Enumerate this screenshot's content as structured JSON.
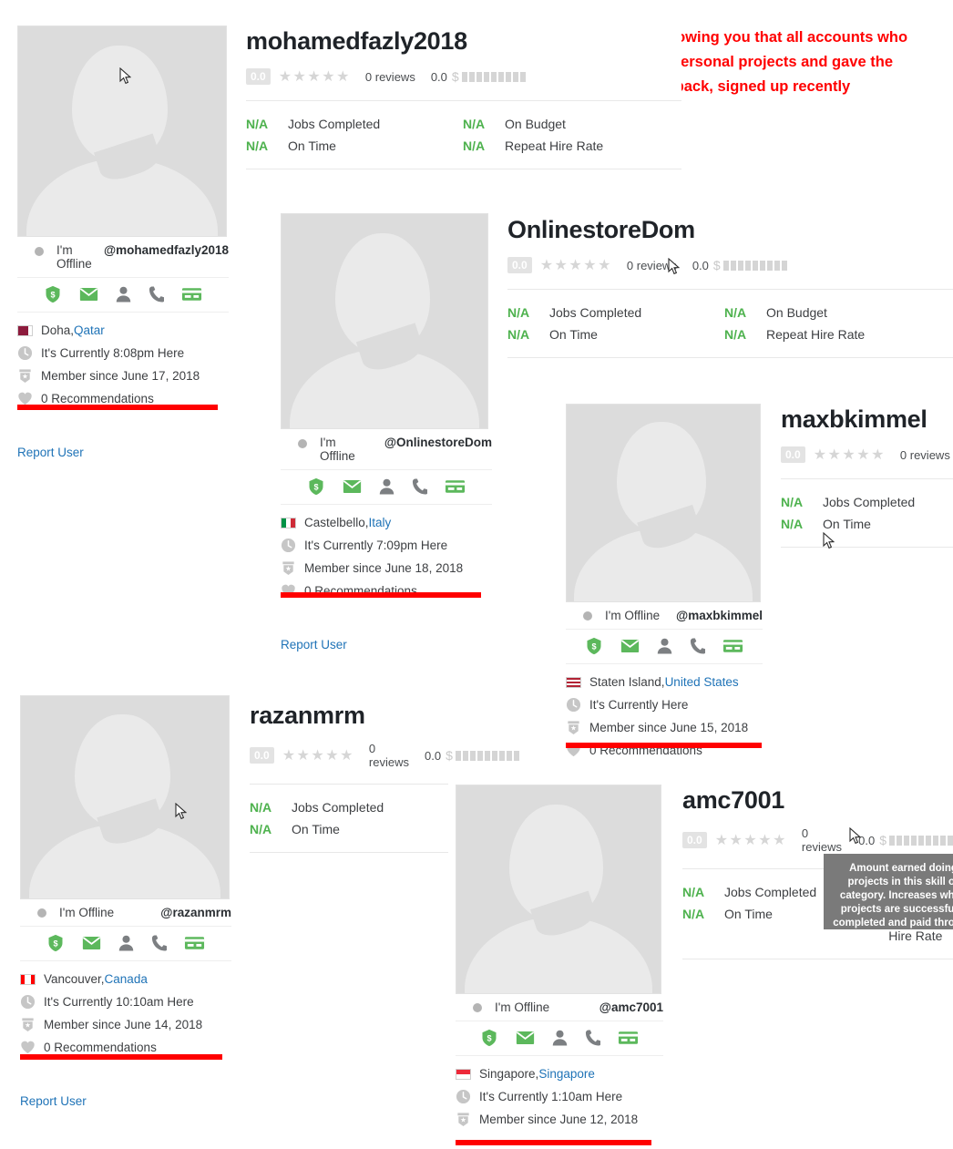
{
  "annotation": {
    "line1": "Here i am showing you that all accounts who",
    "line2": "made the personal projects and gave the",
    "line3": "feedback, signed up recently",
    "color": "#ff0000"
  },
  "labels": {
    "jobs_completed": "Jobs Completed",
    "on_time": "On Time",
    "on_budget": "On Budget",
    "repeat_hire_rate": "Repeat Hire Rate",
    "na": "N/A",
    "reviews": "0 reviews",
    "rating": "0.0",
    "earnings": "0.0",
    "report_user": "Report User",
    "offline": "I'm Offline",
    "offline_wrapped": "I'm Offline",
    "recommendations": "0 Recommendations"
  },
  "tooltip": {
    "text": "Amount earned doing projects in this skill or category. Increases when projects are successfully completed and paid through the site."
  },
  "colors": {
    "green": "#4eb24e",
    "link": "#1f73b7",
    "red": "#ff0000",
    "star": "#d6d6d6"
  },
  "icons": {
    "shield": "shield-dollar-icon",
    "email": "email-icon",
    "person": "person-icon",
    "phone": "phone-icon",
    "card": "payment-card-icon",
    "clock": "clock-icon",
    "member": "member-badge-icon",
    "heart": "heart-icon"
  },
  "profiles": [
    {
      "username": "mohamedfazly2018",
      "handle": "@mohamedfazly2018",
      "status": "I'm Offline",
      "rating": "0.0",
      "reviews": "0 reviews",
      "earnings": "0.0",
      "stats": [
        {
          "value": "N/A",
          "label": "Jobs Completed"
        },
        {
          "value": "N/A",
          "label": "On Time"
        },
        {
          "value": "N/A",
          "label": "On Budget"
        },
        {
          "value": "N/A",
          "label": "Repeat Hire Rate"
        }
      ],
      "city": "Doha, ",
      "country": "Qatar",
      "local_time": "It's Currently 8:08pm Here",
      "member_since": "Member since June 17, 2018",
      "recommendations": "0 Recommendations",
      "report": "Report User",
      "flag_colors": [
        "#8d1b3d",
        "#ffffff"
      ]
    },
    {
      "username": "OnlinestoreDom",
      "handle": "@OnlinestoreDom",
      "status": "I'm Offline",
      "rating": "0.0",
      "reviews": "0 reviews",
      "earnings": "0.0",
      "stats": [
        {
          "value": "N/A",
          "label": "Jobs Completed"
        },
        {
          "value": "N/A",
          "label": "On Time"
        },
        {
          "value": "N/A",
          "label": "On Budget"
        },
        {
          "value": "N/A",
          "label": "Repeat Hire Rate"
        }
      ],
      "city": "Castelbello, ",
      "country": "Italy",
      "local_time": "It's Currently 7:09pm Here",
      "member_since": "Member since June 18, 2018",
      "recommendations": "0 Recommendations",
      "report": "Report User",
      "flag_colors": [
        "#009246",
        "#ffffff",
        "#ce2b37"
      ]
    },
    {
      "username": "maxbkimmel",
      "handle": "@maxbkimmel",
      "status": "I'm Offline",
      "rating": "0.0",
      "reviews": "0 reviews",
      "stats": [
        {
          "value": "N/A",
          "label": "Jobs Completed"
        },
        {
          "value": "N/A",
          "label": "On Time"
        }
      ],
      "city": "Staten Island, ",
      "country": "United States",
      "local_time": "It's Currently Here",
      "member_since": "Member since June 15, 2018",
      "recommendations": "0 Recommendations"
    },
    {
      "username": "razanmrm",
      "handle": "@razanmrm",
      "status": "I'm Offline",
      "rating": "0.0",
      "reviews": "0 reviews",
      "earnings": "0.0",
      "stats": [
        {
          "value": "N/A",
          "label": "Jobs Completed"
        },
        {
          "value": "N/A",
          "label": "On Time"
        }
      ],
      "city": "Vancouver, ",
      "country": "Canada",
      "local_time": "It's Currently 10:10am Here",
      "member_since": "Member since June 14, 2018",
      "recommendations": "0 Recommendations",
      "report": "Report User",
      "flag_colors": [
        "#ff0000",
        "#ffffff",
        "#ff0000"
      ]
    },
    {
      "username": "amc7001",
      "handle": "@amc7001",
      "status": "I'm Offline",
      "rating": "0.0",
      "reviews": "0 reviews",
      "earnings": "0.0",
      "stats": [
        {
          "value": "N/A",
          "label": "Jobs Completed"
        },
        {
          "value": "N/A",
          "label": "On Time"
        }
      ],
      "city": "Singapore, ",
      "country": "Singapore",
      "local_time": "It's Currently 1:10am Here",
      "member_since": "Member since June 12, 2018",
      "flag_colors": [
        "#ed2939",
        "#ffffff"
      ]
    }
  ]
}
